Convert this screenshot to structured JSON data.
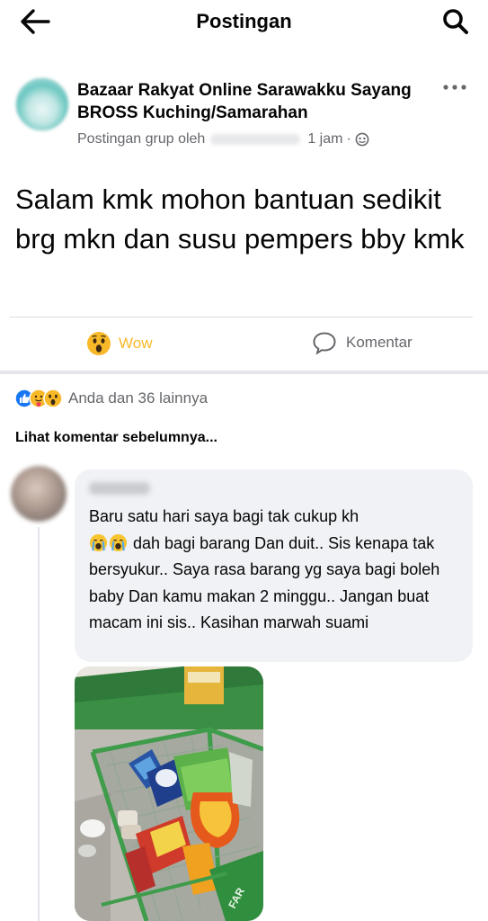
{
  "header": {
    "title": "Postingan"
  },
  "post": {
    "group_name": "Bazaar Rakyat Online Sarawakku Sayang BROSS Kuching/Samarahan",
    "posted_by_prefix": "Postingan grup oleh",
    "time": "1 jam",
    "time_separator": "·",
    "text": "Salam kmk mohon bantuan sedikit brg mkn dan susu pempers bby kmk"
  },
  "actions": {
    "reaction_label": "Wow",
    "comment_label": "Komentar"
  },
  "reactions_summary": {
    "text": "Anda dan 36 lainnya",
    "icons": [
      "like-icon",
      "care-icon",
      "wow-icon"
    ]
  },
  "comments": {
    "see_previous": "Lihat komentar sebelumnya...",
    "items": [
      {
        "text_before_emoji": "Baru satu hari saya bagi tak cukup kh",
        "emoji": "crying-emoji",
        "text_after_emoji": " dah bagi barang Dan duit.. Sis kenapa tak bersyukur.. Saya rasa barang yg saya bagi boleh baby Dan kamu makan 2 minggu.. Jangan buat macam ini sis.. Kasihan marwah suami"
      }
    ]
  },
  "colors": {
    "wow_yellow": "#f7b928",
    "secondary_text": "#65676b",
    "bubble_bg": "#f0f2f5",
    "like_blue": "#1877f2"
  }
}
